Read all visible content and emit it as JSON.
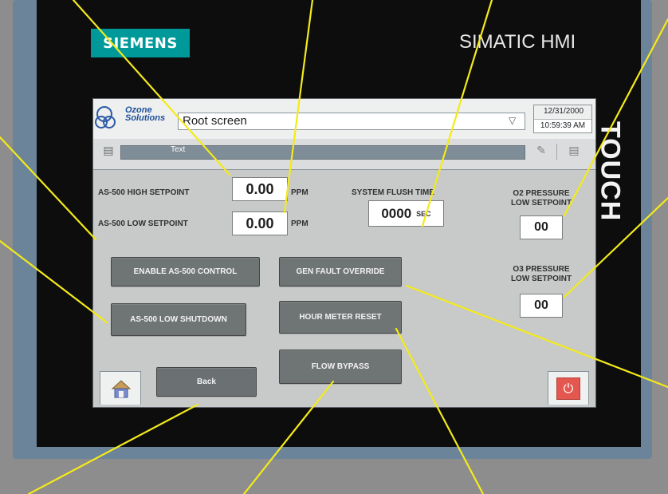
{
  "device": {
    "brand": "SIEMENS",
    "model_label": "SIMATIC HMI",
    "side_label": "TOUCH"
  },
  "screen": {
    "company_logo_line1": "Ozone",
    "company_logo_line2": "Solutions",
    "screen_selector_value": "Root screen",
    "date": "12/31/2000",
    "time": "10:59:39 AM",
    "message_text": "Text"
  },
  "fields": {
    "high_setpoint_label": "AS-500 HIGH SETPOINT",
    "high_setpoint_value": "0.00",
    "high_setpoint_unit": "PPM",
    "low_setpoint_label": "AS-500 LOW SETPOINT",
    "low_setpoint_value": "0.00",
    "low_setpoint_unit": "PPM",
    "flush_time_label": "SYSTEM FLUSH TIME",
    "flush_time_value": "0000",
    "flush_time_unit": "SEC",
    "o2_label_line1": "O2 PRESSURE",
    "o2_label_line2": "LOW SETPOINT",
    "o2_value": "00",
    "o3_label_line1": "O3 PRESSURE",
    "o3_label_line2": "LOW SETPOINT",
    "o3_value": "00"
  },
  "buttons": {
    "enable_control": "ENABLE AS-500 CONTROL",
    "low_shutdown": "AS-500 LOW SHUTDOWN",
    "gen_fault_override": "GEN FAULT OVERRIDE",
    "hour_meter_reset": "HOUR METER RESET",
    "flow_bypass": "FLOW BYPASS",
    "back": "Back"
  },
  "icons": {
    "home": "home-icon",
    "power": "power-icon",
    "dropdown": "chevron-down-icon",
    "help": "help-icon",
    "acknowledge": "acknowledge-icon",
    "edit": "edit-icon"
  },
  "colors": {
    "siemens_brand": "#009999",
    "frame": "#6b8499",
    "callout_line": "#f4ea1a",
    "button": "#6f7475",
    "screen_bg": "#c7cac9"
  }
}
